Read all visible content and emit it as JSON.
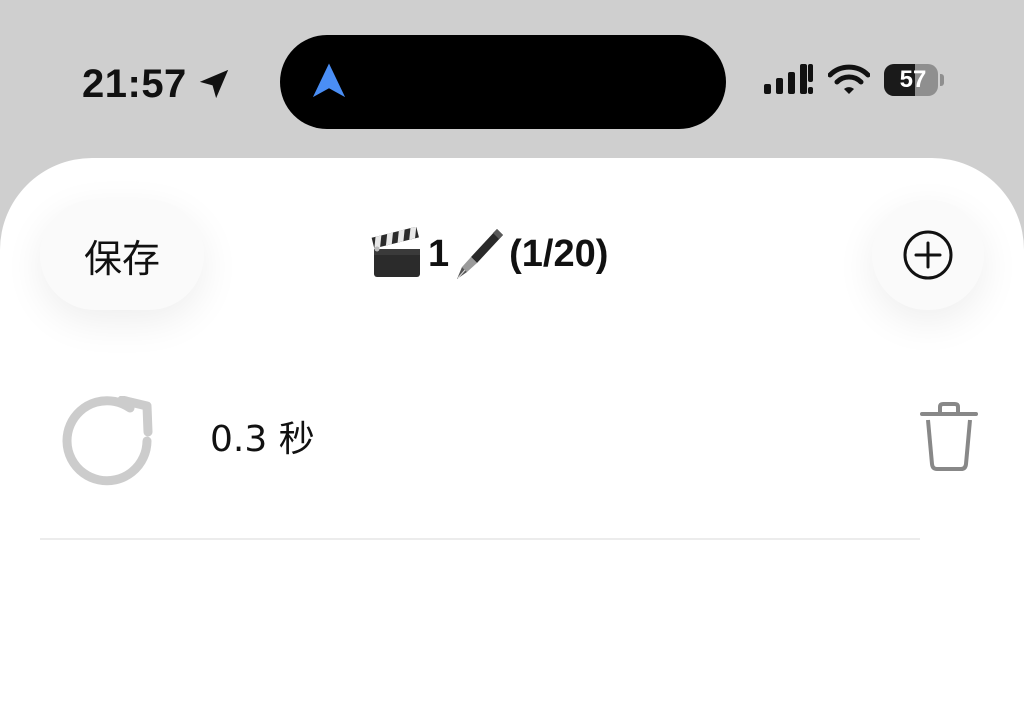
{
  "status_bar": {
    "time": "21:57",
    "battery": {
      "percent": 57,
      "label": "57"
    },
    "icons": [
      "location-arrow-icon",
      "navigation-arrow-icon",
      "cellular-signal-icon",
      "wifi-icon",
      "battery-icon"
    ],
    "nav_arrow_color": "#4a8ef5"
  },
  "toolbar": {
    "save_label": "保存",
    "title_number": "1",
    "title_count": "(1/20)",
    "title_icons": [
      "clapper-board-icon",
      "fountain-pen-icon"
    ]
  },
  "rows": [
    {
      "duration": "0.3 秒",
      "icon": "refresh-icon",
      "action_icon": "trash-icon"
    }
  ],
  "colors": {
    "background": "#cfcfcf",
    "sheet": "#ffffff",
    "muted_icon": "#cccccc",
    "divider": "#ececec"
  }
}
